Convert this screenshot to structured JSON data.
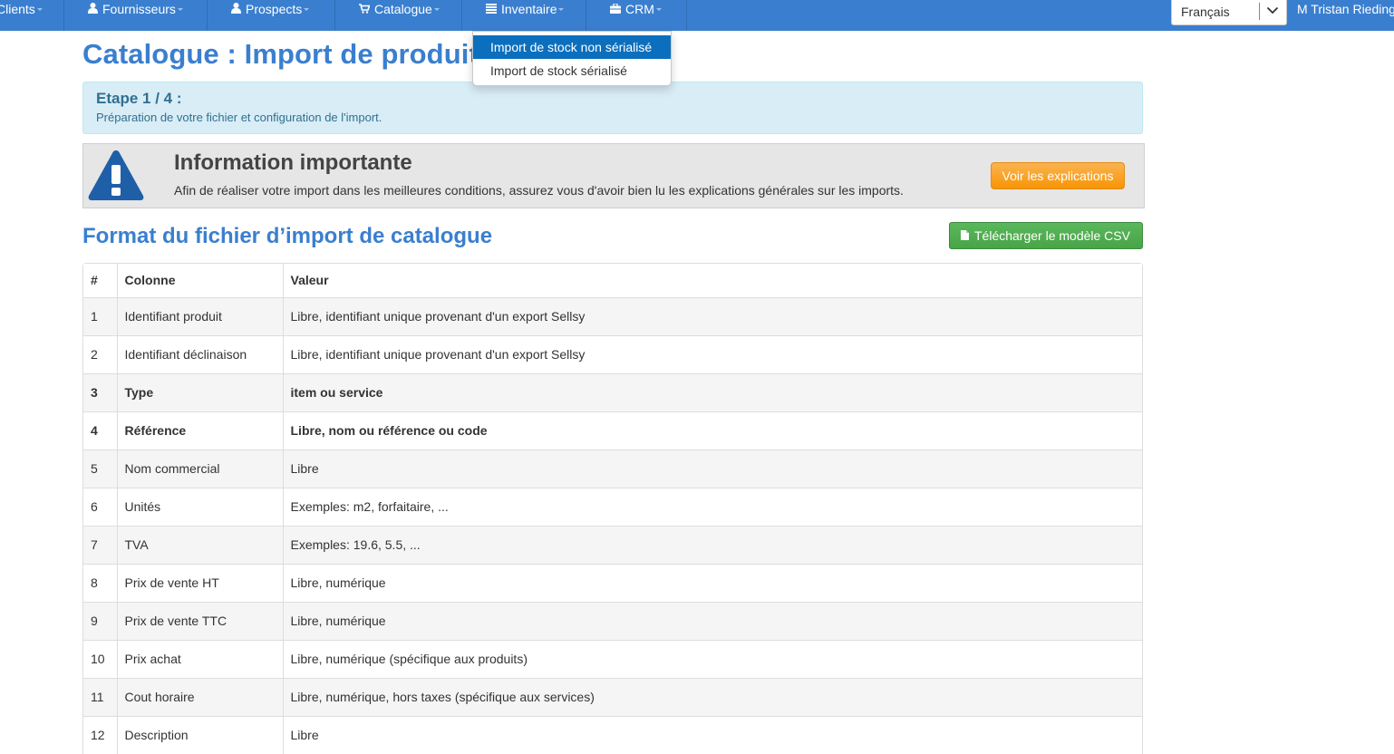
{
  "nav": {
    "items": [
      {
        "label": "Clients",
        "icon": "none"
      },
      {
        "label": "Fournisseurs",
        "icon": "user-icon"
      },
      {
        "label": "Prospects",
        "icon": "user-icon"
      },
      {
        "label": "Catalogue",
        "icon": "cart-icon"
      },
      {
        "label": "Inventaire",
        "icon": "list-icon"
      },
      {
        "label": "CRM",
        "icon": "briefcase-icon"
      }
    ],
    "language": "Français",
    "user": "M Tristan Riedinger"
  },
  "dropdown": {
    "items": [
      {
        "label": "Import de stock non sérialisé",
        "active": true
      },
      {
        "label": "Import de stock sérialisé",
        "active": false
      }
    ]
  },
  "page": {
    "title": "Catalogue : Import de produits"
  },
  "step": {
    "title": "Etape 1 / 4 :",
    "description": "Préparation de votre fichier et configuration de l'import."
  },
  "info": {
    "title": "Information importante",
    "text": "Afin de réaliser votre import dans les meilleures conditions, assurez vous d'avoir bien lu les explications générales sur les imports.",
    "button_label": "Voir les explications"
  },
  "section": {
    "title": "Format du fichier d’import de catalogue",
    "download_label": "Télécharger le modèle CSV"
  },
  "table": {
    "headers": [
      "#",
      "Colonne",
      "Valeur"
    ],
    "rows": [
      {
        "num": "1",
        "col": "Identifiant produit",
        "val": "Libre, identifiant unique provenant d'un export Sellsy",
        "bold": false
      },
      {
        "num": "2",
        "col": "Identifiant déclinaison",
        "val": "Libre, identifiant unique provenant d'un export Sellsy",
        "bold": false
      },
      {
        "num": "3",
        "col": "Type",
        "val": "item ou service",
        "bold": true
      },
      {
        "num": "4",
        "col": "Référence",
        "val": "Libre, nom ou référence ou code",
        "bold": true
      },
      {
        "num": "5",
        "col": "Nom commercial",
        "val": "Libre",
        "bold": false
      },
      {
        "num": "6",
        "col": "Unités",
        "val": "Exemples: m2, forfaitaire, ...",
        "bold": false
      },
      {
        "num": "7",
        "col": "TVA",
        "val": "Exemples: 19.6, 5.5, ...",
        "bold": false
      },
      {
        "num": "8",
        "col": "Prix de vente HT",
        "val": "Libre, numérique",
        "bold": false
      },
      {
        "num": "9",
        "col": "Prix de vente TTC",
        "val": "Libre, numérique",
        "bold": false
      },
      {
        "num": "10",
        "col": "Prix achat",
        "val": "Libre, numérique (spécifique aux produits)",
        "bold": false
      },
      {
        "num": "11",
        "col": "Cout horaire",
        "val": "Libre, numérique, hors taxes (spécifique aux services)",
        "bold": false
      },
      {
        "num": "12",
        "col": "Description",
        "val": "Libre",
        "bold": false
      }
    ]
  },
  "colors": {
    "navbar": "#3a7fcf",
    "title": "#3a7fcf",
    "step_bg": "#d9edf7",
    "step_text": "#31708f",
    "warning_icon": "#1f5fa8",
    "orange_button": "#f89406",
    "green_button": "#47a447",
    "dropdown_active": "#0b6fbe"
  }
}
